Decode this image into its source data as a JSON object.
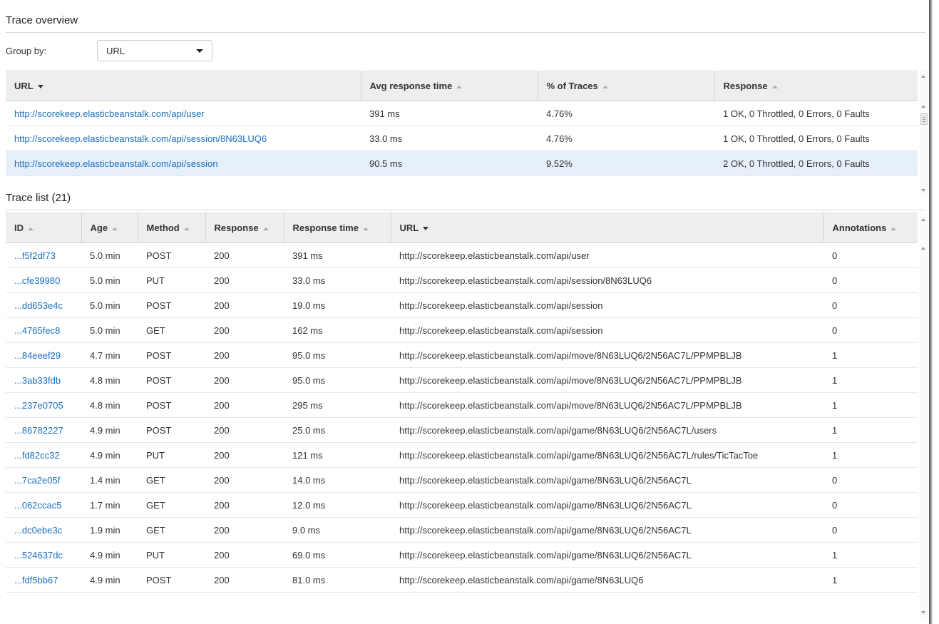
{
  "overview": {
    "title": "Trace overview",
    "group_by_label": "Group by:",
    "group_by_value": "URL",
    "columns": [
      "URL",
      "Avg response time",
      "% of Traces",
      "Response"
    ],
    "rows": [
      {
        "url": "http://scorekeep.elasticbeanstalk.com/api/user",
        "avg": "391 ms",
        "pct": "4.76%",
        "response": "1 OK, 0 Throttled, 0 Errors, 0 Faults",
        "selected": false
      },
      {
        "url": "http://scorekeep.elasticbeanstalk.com/api/session/8N63LUQ6",
        "avg": "33.0 ms",
        "pct": "4.76%",
        "response": "1 OK, 0 Throttled, 0 Errors, 0 Faults",
        "selected": false
      },
      {
        "url": "http://scorekeep.elasticbeanstalk.com/api/session",
        "avg": "90.5 ms",
        "pct": "9.52%",
        "response": "2 OK, 0 Throttled, 0 Errors, 0 Faults",
        "selected": true
      }
    ]
  },
  "trace_list": {
    "title": "Trace list (21)",
    "columns": [
      "ID",
      "Age",
      "Method",
      "Response",
      "Response time",
      "URL",
      "Annotations"
    ],
    "rows": [
      {
        "id": "...f5f2df73",
        "age": "5.0 min",
        "method": "POST",
        "response": "200",
        "time": "391 ms",
        "url": "http://scorekeep.elasticbeanstalk.com/api/user",
        "annotations": "0"
      },
      {
        "id": "...cfe39980",
        "age": "5.0 min",
        "method": "PUT",
        "response": "200",
        "time": "33.0 ms",
        "url": "http://scorekeep.elasticbeanstalk.com/api/session/8N63LUQ6",
        "annotations": "0"
      },
      {
        "id": "...dd653e4c",
        "age": "5.0 min",
        "method": "POST",
        "response": "200",
        "time": "19.0 ms",
        "url": "http://scorekeep.elasticbeanstalk.com/api/session",
        "annotations": "0"
      },
      {
        "id": "...4765fec8",
        "age": "5.0 min",
        "method": "GET",
        "response": "200",
        "time": "162 ms",
        "url": "http://scorekeep.elasticbeanstalk.com/api/session",
        "annotations": "0"
      },
      {
        "id": "...84eeef29",
        "age": "4.7 min",
        "method": "POST",
        "response": "200",
        "time": "95.0 ms",
        "url": "http://scorekeep.elasticbeanstalk.com/api/move/8N63LUQ6/2N56AC7L/PPMPBLJB",
        "annotations": "1"
      },
      {
        "id": "...3ab33fdb",
        "age": "4.8 min",
        "method": "POST",
        "response": "200",
        "time": "95.0 ms",
        "url": "http://scorekeep.elasticbeanstalk.com/api/move/8N63LUQ6/2N56AC7L/PPMPBLJB",
        "annotations": "1"
      },
      {
        "id": "...237e0705",
        "age": "4.8 min",
        "method": "POST",
        "response": "200",
        "time": "295 ms",
        "url": "http://scorekeep.elasticbeanstalk.com/api/move/8N63LUQ6/2N56AC7L/PPMPBLJB",
        "annotations": "1"
      },
      {
        "id": "...86782227",
        "age": "4.9 min",
        "method": "POST",
        "response": "200",
        "time": "25.0 ms",
        "url": "http://scorekeep.elasticbeanstalk.com/api/game/8N63LUQ6/2N56AC7L/users",
        "annotations": "1"
      },
      {
        "id": "...fd82cc32",
        "age": "4.9 min",
        "method": "PUT",
        "response": "200",
        "time": "121 ms",
        "url": "http://scorekeep.elasticbeanstalk.com/api/game/8N63LUQ6/2N56AC7L/rules/TicTacToe",
        "annotations": "1"
      },
      {
        "id": "...7ca2e05f",
        "age": "1.4 min",
        "method": "GET",
        "response": "200",
        "time": "14.0 ms",
        "url": "http://scorekeep.elasticbeanstalk.com/api/game/8N63LUQ6/2N56AC7L",
        "annotations": "0"
      },
      {
        "id": "...062ccac5",
        "age": "1.7 min",
        "method": "GET",
        "response": "200",
        "time": "12.0 ms",
        "url": "http://scorekeep.elasticbeanstalk.com/api/game/8N63LUQ6/2N56AC7L",
        "annotations": "0"
      },
      {
        "id": "...dc0ebe3c",
        "age": "1.9 min",
        "method": "GET",
        "response": "200",
        "time": "9.0 ms",
        "url": "http://scorekeep.elasticbeanstalk.com/api/game/8N63LUQ6/2N56AC7L",
        "annotations": "0"
      },
      {
        "id": "...524637dc",
        "age": "4.9 min",
        "method": "PUT",
        "response": "200",
        "time": "69.0 ms",
        "url": "http://scorekeep.elasticbeanstalk.com/api/game/8N63LUQ6/2N56AC7L",
        "annotations": "1"
      },
      {
        "id": "...fdf5bb67",
        "age": "4.9 min",
        "method": "POST",
        "response": "200",
        "time": "81.0 ms",
        "url": "http://scorekeep.elasticbeanstalk.com/api/game/8N63LUQ6",
        "annotations": "1"
      }
    ]
  },
  "colors": {
    "link": "#1a6fbf",
    "header_bg": "#eeeeee",
    "selected_row_bg": "#e6f0fa"
  }
}
